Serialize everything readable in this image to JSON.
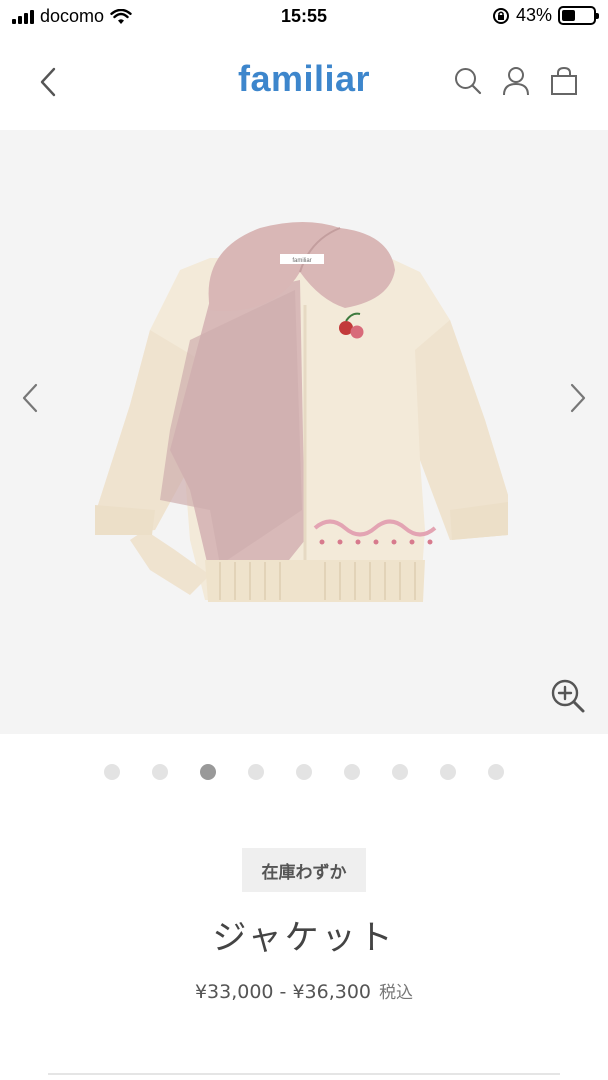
{
  "status_bar": {
    "carrier": "docomo",
    "time": "15:55",
    "battery_percent": "43%",
    "battery_level": 0.43,
    "icons": [
      "signal-icon",
      "wifi-icon",
      "orientation-lock-icon",
      "battery-icon"
    ]
  },
  "header": {
    "logo": "familiar",
    "brand_color": "#3d86cc",
    "icons": [
      "back-chevron-icon",
      "search-icon",
      "user-icon",
      "shopping-bag-icon"
    ]
  },
  "gallery": {
    "image_subject": "cream knit zip-up jacket with pink fleece lining",
    "garment_label_text": "familiar",
    "slide_count": 9,
    "active_slide": 3,
    "background": "#f4f4f4"
  },
  "product": {
    "badge": "在庫わずか",
    "name": "ジャケット",
    "price_range": "¥33,000 - ¥36,300",
    "tax_label": "税込"
  }
}
